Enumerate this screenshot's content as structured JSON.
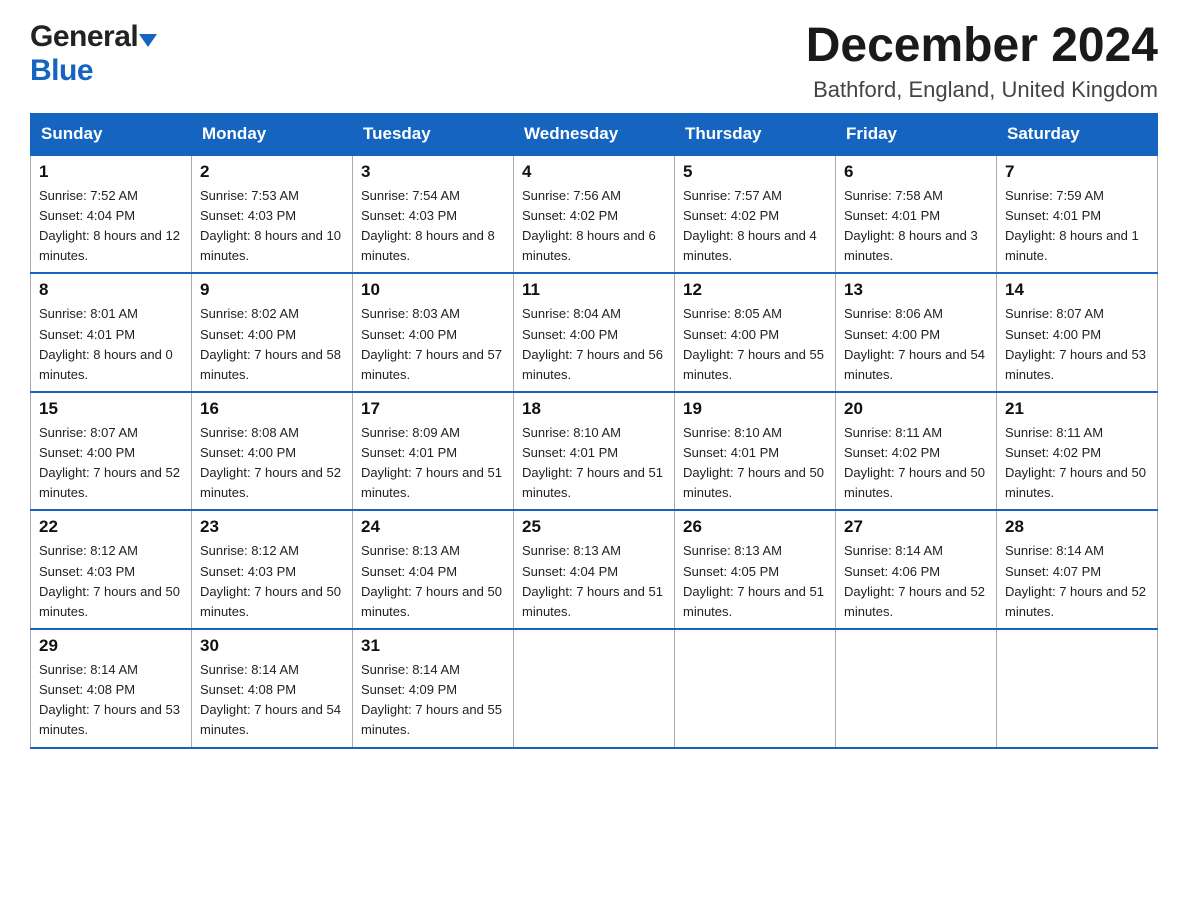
{
  "logo": {
    "general": "General",
    "blue": "Blue"
  },
  "title": {
    "month_year": "December 2024",
    "location": "Bathford, England, United Kingdom"
  },
  "headers": [
    "Sunday",
    "Monday",
    "Tuesday",
    "Wednesday",
    "Thursday",
    "Friday",
    "Saturday"
  ],
  "weeks": [
    [
      {
        "day": "1",
        "sunrise": "Sunrise: 7:52 AM",
        "sunset": "Sunset: 4:04 PM",
        "daylight": "Daylight: 8 hours and 12 minutes."
      },
      {
        "day": "2",
        "sunrise": "Sunrise: 7:53 AM",
        "sunset": "Sunset: 4:03 PM",
        "daylight": "Daylight: 8 hours and 10 minutes."
      },
      {
        "day": "3",
        "sunrise": "Sunrise: 7:54 AM",
        "sunset": "Sunset: 4:03 PM",
        "daylight": "Daylight: 8 hours and 8 minutes."
      },
      {
        "day": "4",
        "sunrise": "Sunrise: 7:56 AM",
        "sunset": "Sunset: 4:02 PM",
        "daylight": "Daylight: 8 hours and 6 minutes."
      },
      {
        "day": "5",
        "sunrise": "Sunrise: 7:57 AM",
        "sunset": "Sunset: 4:02 PM",
        "daylight": "Daylight: 8 hours and 4 minutes."
      },
      {
        "day": "6",
        "sunrise": "Sunrise: 7:58 AM",
        "sunset": "Sunset: 4:01 PM",
        "daylight": "Daylight: 8 hours and 3 minutes."
      },
      {
        "day": "7",
        "sunrise": "Sunrise: 7:59 AM",
        "sunset": "Sunset: 4:01 PM",
        "daylight": "Daylight: 8 hours and 1 minute."
      }
    ],
    [
      {
        "day": "8",
        "sunrise": "Sunrise: 8:01 AM",
        "sunset": "Sunset: 4:01 PM",
        "daylight": "Daylight: 8 hours and 0 minutes."
      },
      {
        "day": "9",
        "sunrise": "Sunrise: 8:02 AM",
        "sunset": "Sunset: 4:00 PM",
        "daylight": "Daylight: 7 hours and 58 minutes."
      },
      {
        "day": "10",
        "sunrise": "Sunrise: 8:03 AM",
        "sunset": "Sunset: 4:00 PM",
        "daylight": "Daylight: 7 hours and 57 minutes."
      },
      {
        "day": "11",
        "sunrise": "Sunrise: 8:04 AM",
        "sunset": "Sunset: 4:00 PM",
        "daylight": "Daylight: 7 hours and 56 minutes."
      },
      {
        "day": "12",
        "sunrise": "Sunrise: 8:05 AM",
        "sunset": "Sunset: 4:00 PM",
        "daylight": "Daylight: 7 hours and 55 minutes."
      },
      {
        "day": "13",
        "sunrise": "Sunrise: 8:06 AM",
        "sunset": "Sunset: 4:00 PM",
        "daylight": "Daylight: 7 hours and 54 minutes."
      },
      {
        "day": "14",
        "sunrise": "Sunrise: 8:07 AM",
        "sunset": "Sunset: 4:00 PM",
        "daylight": "Daylight: 7 hours and 53 minutes."
      }
    ],
    [
      {
        "day": "15",
        "sunrise": "Sunrise: 8:07 AM",
        "sunset": "Sunset: 4:00 PM",
        "daylight": "Daylight: 7 hours and 52 minutes."
      },
      {
        "day": "16",
        "sunrise": "Sunrise: 8:08 AM",
        "sunset": "Sunset: 4:00 PM",
        "daylight": "Daylight: 7 hours and 52 minutes."
      },
      {
        "day": "17",
        "sunrise": "Sunrise: 8:09 AM",
        "sunset": "Sunset: 4:01 PM",
        "daylight": "Daylight: 7 hours and 51 minutes."
      },
      {
        "day": "18",
        "sunrise": "Sunrise: 8:10 AM",
        "sunset": "Sunset: 4:01 PM",
        "daylight": "Daylight: 7 hours and 51 minutes."
      },
      {
        "day": "19",
        "sunrise": "Sunrise: 8:10 AM",
        "sunset": "Sunset: 4:01 PM",
        "daylight": "Daylight: 7 hours and 50 minutes."
      },
      {
        "day": "20",
        "sunrise": "Sunrise: 8:11 AM",
        "sunset": "Sunset: 4:02 PM",
        "daylight": "Daylight: 7 hours and 50 minutes."
      },
      {
        "day": "21",
        "sunrise": "Sunrise: 8:11 AM",
        "sunset": "Sunset: 4:02 PM",
        "daylight": "Daylight: 7 hours and 50 minutes."
      }
    ],
    [
      {
        "day": "22",
        "sunrise": "Sunrise: 8:12 AM",
        "sunset": "Sunset: 4:03 PM",
        "daylight": "Daylight: 7 hours and 50 minutes."
      },
      {
        "day": "23",
        "sunrise": "Sunrise: 8:12 AM",
        "sunset": "Sunset: 4:03 PM",
        "daylight": "Daylight: 7 hours and 50 minutes."
      },
      {
        "day": "24",
        "sunrise": "Sunrise: 8:13 AM",
        "sunset": "Sunset: 4:04 PM",
        "daylight": "Daylight: 7 hours and 50 minutes."
      },
      {
        "day": "25",
        "sunrise": "Sunrise: 8:13 AM",
        "sunset": "Sunset: 4:04 PM",
        "daylight": "Daylight: 7 hours and 51 minutes."
      },
      {
        "day": "26",
        "sunrise": "Sunrise: 8:13 AM",
        "sunset": "Sunset: 4:05 PM",
        "daylight": "Daylight: 7 hours and 51 minutes."
      },
      {
        "day": "27",
        "sunrise": "Sunrise: 8:14 AM",
        "sunset": "Sunset: 4:06 PM",
        "daylight": "Daylight: 7 hours and 52 minutes."
      },
      {
        "day": "28",
        "sunrise": "Sunrise: 8:14 AM",
        "sunset": "Sunset: 4:07 PM",
        "daylight": "Daylight: 7 hours and 52 minutes."
      }
    ],
    [
      {
        "day": "29",
        "sunrise": "Sunrise: 8:14 AM",
        "sunset": "Sunset: 4:08 PM",
        "daylight": "Daylight: 7 hours and 53 minutes."
      },
      {
        "day": "30",
        "sunrise": "Sunrise: 8:14 AM",
        "sunset": "Sunset: 4:08 PM",
        "daylight": "Daylight: 7 hours and 54 minutes."
      },
      {
        "day": "31",
        "sunrise": "Sunrise: 8:14 AM",
        "sunset": "Sunset: 4:09 PM",
        "daylight": "Daylight: 7 hours and 55 minutes."
      },
      null,
      null,
      null,
      null
    ]
  ]
}
